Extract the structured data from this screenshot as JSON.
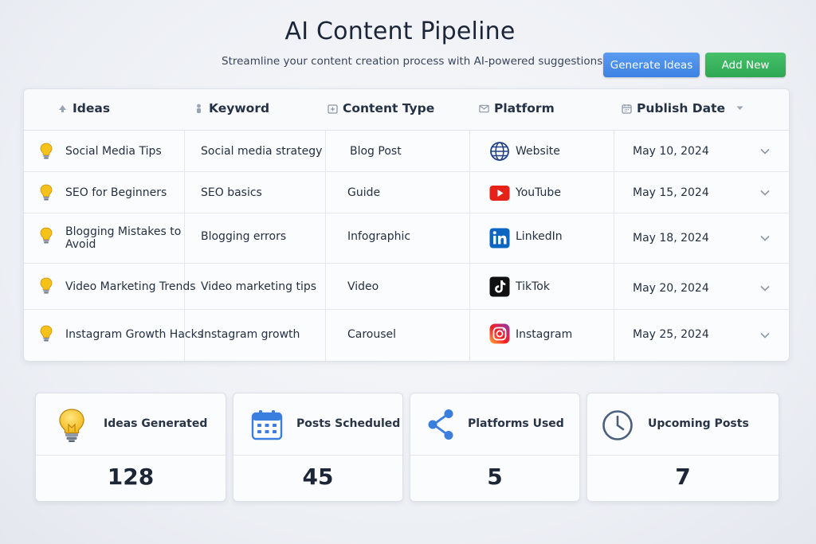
{
  "header": {
    "title": "AI Content Pipeline",
    "subtitle": "Streamline your content creation process with AI-powered suggestions.",
    "generate_label": "Generate Ideas",
    "add_label": "Add New"
  },
  "table": {
    "columns": [
      "Ideas",
      "Keyword",
      "Content Type",
      "Platform",
      "Publish Date"
    ],
    "rows": [
      {
        "idea": "Social Media Tips",
        "keyword": "Social media strategy",
        "type": "Blog Post",
        "platform": "Website",
        "date": "May 10, 2024",
        "platform_icon": "globe-icon"
      },
      {
        "idea": "SEO for Beginners",
        "keyword": "SEO basics",
        "type": "Guide",
        "platform": "YouTube",
        "date": "May 15, 2024",
        "platform_icon": "youtube-icon"
      },
      {
        "idea": "Blogging Mistakes to Avoid",
        "keyword": "Blogging errors",
        "type": "Infographic",
        "platform": "LinkedIn",
        "date": "May 18, 2024",
        "platform_icon": "linkedin-icon"
      },
      {
        "idea": "Video Marketing Trends",
        "keyword": "Video marketing tips",
        "type": "Video",
        "platform": "TikTok",
        "date": "May 20, 2024",
        "platform_icon": "tiktok-icon"
      },
      {
        "idea": "Instagram Growth Hacks",
        "keyword": "Instagram growth",
        "type": "Carousel",
        "platform": "Instagram",
        "date": "May 25, 2024",
        "platform_icon": "instagram-icon"
      }
    ]
  },
  "stats": [
    {
      "label": "Ideas Generated",
      "value": "128",
      "icon": "lightbulb-icon"
    },
    {
      "label": "Posts Scheduled",
      "value": "45",
      "icon": "calendar-icon"
    },
    {
      "label": "Platforms Used",
      "value": "5",
      "icon": "share-icon"
    },
    {
      "label": "Upcoming Posts",
      "value": "7",
      "icon": "clock-icon"
    }
  ],
  "colors": {
    "primary_blue": "#3d82e3",
    "primary_green": "#2fa854",
    "youtube_red": "#e62117",
    "linkedin_blue": "#0a66c2",
    "bulb_yellow": "#f5c21b"
  }
}
